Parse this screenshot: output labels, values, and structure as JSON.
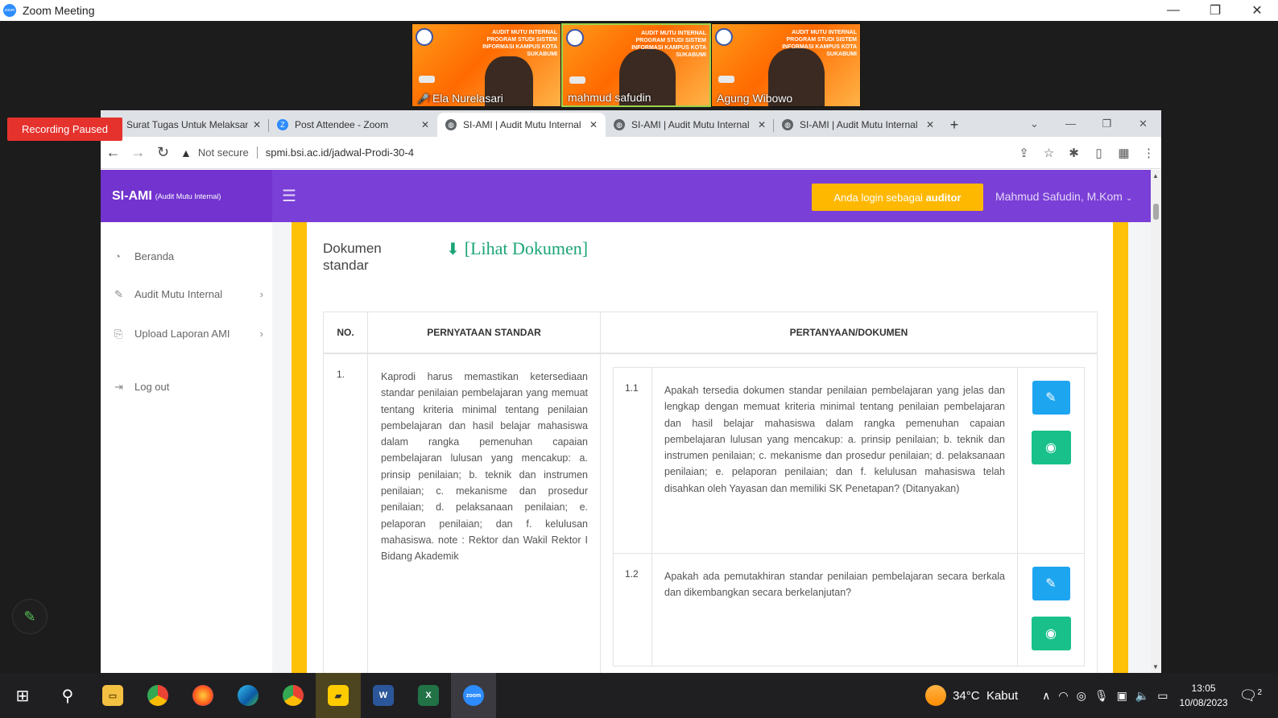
{
  "zoom": {
    "window_title": "Zoom Meeting",
    "recording_status": "Recording Paused",
    "participants": [
      {
        "name": "Ela Nurelasari",
        "muted": true
      },
      {
        "name": "mahmud safudin",
        "muted": false,
        "active": true
      },
      {
        "name": "Agung Wibowo",
        "muted": false
      }
    ],
    "banner_text": "AUDIT MUTU INTERNAL PROGRAM STUDI SISTEM INFORMASI KAMPUS KOTA SUKABUMI"
  },
  "browser": {
    "tabs": [
      {
        "label": "Surat Tugas Untuk Melaksan",
        "active": false,
        "favicon_color": "#34a853"
      },
      {
        "label": "Post Attendee - Zoom",
        "active": false,
        "favicon_color": "#2d8cff"
      },
      {
        "label": "SI-AMI | Audit Mutu Internal",
        "active": true,
        "favicon_color": "#5f6368"
      },
      {
        "label": "SI-AMI | Audit Mutu Internal",
        "active": false,
        "favicon_color": "#5f6368"
      },
      {
        "label": "SI-AMI | Audit Mutu Internal",
        "active": false,
        "favicon_color": "#5f6368"
      }
    ],
    "security_label": "Not secure",
    "url": "spmi.bsi.ac.id/jadwal-Prodi-30-4"
  },
  "app": {
    "brand": "SI-AMI",
    "brand_sub": "(Audit Mutu Internal)",
    "login_badge_prefix": "Anda login sebagai ",
    "login_badge_role": "auditor",
    "user_name": "Mahmud Safudin, M.Kom",
    "accent_color": "#7a3fd6",
    "sidebar": [
      {
        "label": "Beranda",
        "icon": "dashboard-icon",
        "has_children": false
      },
      {
        "label": "Audit Mutu Internal",
        "icon": "edit-icon",
        "has_children": true
      },
      {
        "label": "Upload Laporan AMI",
        "icon": "upload-icon",
        "has_children": true
      },
      {
        "label": "Log out",
        "icon": "logout-icon",
        "has_children": false
      }
    ]
  },
  "document": {
    "label": "Dokumen standar",
    "link": "[Lihat Dokumen]"
  },
  "table": {
    "headers": [
      "NO.",
      "PERNYATAAN STANDAR",
      "PERTANYAAN/DOKUMEN"
    ],
    "rows": [
      {
        "no": "1.",
        "statement": "Kaprodi harus memastikan ketersediaan standar penilaian pembelajaran yang memuat tentang kriteria minimal tentang penilaian pembelajaran dan hasil belajar mahasiswa dalam rangka pemenuhan capaian pembelajaran lulusan yang mencakup: a. prinsip penilaian; b. teknik dan instrumen penilaian; c. mekanisme dan prosedur penilaian; d. pelaksanaan penilaian; e. pelaporan penilaian; dan f. kelulusan mahasiswa. note : Rektor dan Wakil Rektor I Bidang Akademik",
        "questions": [
          {
            "no": "1.1",
            "text": "Apakah tersedia dokumen standar penilaian pembelajaran yang jelas dan lengkap dengan memuat kriteria minimal tentang penilaian pembelajaran dan hasil belajar mahasiswa dalam rangka pemenuhan capaian pembelajaran lulusan yang mencakup: a. prinsip penilaian; b. teknik dan instrumen penilaian; c. mekanisme dan prosedur penilaian; d. pelaksanaan penilaian; e. pelaporan penilaian; dan f. kelulusan mahasiswa telah disahkan oleh Yayasan dan memiliki SK Penetapan? (Ditanyakan)"
          },
          {
            "no": "1.2",
            "text": "Apakah ada pemutakhiran standar penilaian pembelajaran secara berkala dan dikembangkan secara berkelanjutan?"
          }
        ]
      }
    ]
  },
  "taskbar": {
    "weather_temp": "34°C",
    "weather_desc": "Kabut",
    "time": "13:05",
    "date": "10/08/2023",
    "notification_count": "2",
    "apps": [
      "start",
      "search",
      "file-explorer",
      "chrome",
      "firefox",
      "edge",
      "chrome-profile",
      "sticky-notes",
      "word",
      "excel",
      "zoom"
    ]
  }
}
